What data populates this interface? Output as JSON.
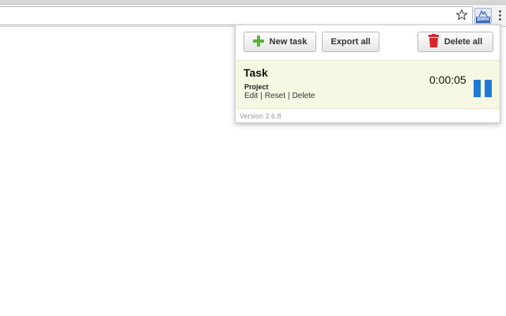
{
  "browser": {
    "star_icon": "star-icon",
    "extension_badge": "BWN",
    "menu_icon": "more-vert-icon"
  },
  "popup": {
    "buttons": {
      "new_task": "New task",
      "export_all": "Export all",
      "delete_all": "Delete all"
    },
    "task": {
      "name": "Task",
      "project": "Project",
      "actions": [
        "Edit",
        "Reset",
        "Delete"
      ],
      "separator": "|",
      "timer": "0:00:05"
    },
    "version": "Version 2.6.8"
  },
  "colors": {
    "plus_green": "#5bb43a",
    "trash_red": "#d9252c",
    "pause_blue": "#1f78d8",
    "task_bg": "#f6f8e4"
  }
}
